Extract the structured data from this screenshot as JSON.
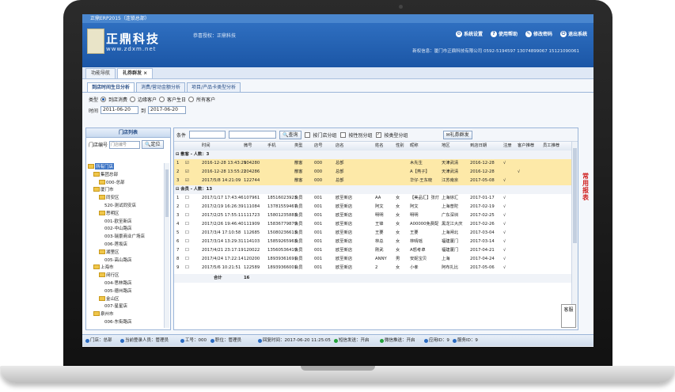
{
  "window": {
    "title": "正鼎ERP2015（连锁总部）"
  },
  "brand": {
    "name": "正鼎科技",
    "url": "www.zdxm.net"
  },
  "header": {
    "authorized": "恭喜授权：正鼎科技",
    "buttons": [
      "系统设置",
      "使用帮助",
      "修改密码",
      "退出系统"
    ],
    "new_info": "新权信息：厦门市正鼎科技有限公司  0592-5194597 13074899067 15121090061"
  },
  "tabs": [
    "功能导航",
    "礼券群发"
  ],
  "subtabs": [
    "到店时间生日分析",
    "消费/营动金额分析",
    "项目/产品卡类型分析"
  ],
  "filters": {
    "type_label": "类型",
    "type_options": [
      "到店消费",
      "边缘客户",
      "客户生日",
      "所有客户"
    ],
    "time_label": "时间",
    "date_from": "2011-06-20",
    "to_label": "到",
    "date_to": "2017-06-20"
  },
  "store_panel": {
    "title": "门店列表",
    "search_label": "门店编号",
    "search_placeholder": "门店编号",
    "locate_label": "定位",
    "tree": [
      {
        "label": "所有门店",
        "level": 0,
        "sel": true
      },
      {
        "label": "集团总部",
        "level": 1
      },
      {
        "label": "000-总部",
        "level": 2
      },
      {
        "label": "厦门市",
        "level": 1
      },
      {
        "label": "同安区",
        "level": 2
      },
      {
        "label": "520-测试同安店",
        "level": 3
      },
      {
        "label": "思明区",
        "level": 2
      },
      {
        "label": "001-欧至新店",
        "level": 3
      },
      {
        "label": "002-中山路店",
        "level": 3
      },
      {
        "label": "003-瑞景商业广场店",
        "level": 3
      },
      {
        "label": "006-莲坂店",
        "level": 3
      },
      {
        "label": "湖里区",
        "level": 2
      },
      {
        "label": "005-高山路店",
        "level": 3
      },
      {
        "label": "上海市",
        "level": 1
      },
      {
        "label": "闵行区",
        "level": 2
      },
      {
        "label": "004-思林路店",
        "level": 3
      },
      {
        "label": "005-德州路店",
        "level": 3
      },
      {
        "label": "金山区",
        "level": 2
      },
      {
        "label": "007-星星店",
        "level": 3
      },
      {
        "label": "泉州市",
        "level": 1
      },
      {
        "label": "006-东街路店",
        "level": 3
      }
    ]
  },
  "grid": {
    "toolbar": {
      "condition_label": "条件",
      "query_button": "查询",
      "group_by_store": "按门店分组",
      "group_by_gender": "按性别分组",
      "group_by_type": "按类型分组",
      "send_button": "礼券群发"
    },
    "columns": [
      "时间",
      "微号",
      "手机",
      "类型",
      "店号",
      "店名",
      "姓名",
      "性别",
      "昵称",
      "地区",
      "到店日期",
      "注册",
      "客户推荐",
      "员工推荐"
    ],
    "group1": "散客 - 人数：3",
    "rows1": [
      [
        "2016-12-28 13:43:29",
        "104280",
        "",
        "散客",
        "000",
        "总部",
        "",
        "",
        "木先生",
        "天津武清",
        "2016-12-28",
        "√",
        "",
        ""
      ],
      [
        "2016-12-28 13:55:22",
        "104286",
        "",
        "散客",
        "000",
        "总部",
        "",
        "",
        "A【燕子】",
        "天津武清",
        "2016-12-28",
        "",
        "√",
        ""
      ],
      [
        "2017/5/8 14:21:09",
        "122744",
        "",
        "散客",
        "000",
        "总部",
        "",
        "",
        "华仔·王东晓",
        "江苏南京",
        "2017-05-08",
        "√",
        "",
        ""
      ]
    ],
    "group2": "会员 - 人数：13",
    "rows2": [
      [
        "2017/1/17 17:43:46",
        "107961",
        "18516023923",
        "会员",
        "001",
        "欧至新店",
        "AA",
        "女",
        "【美品汇】张灯",
        "上海徐汇",
        "2017-01-17",
        "√",
        "",
        ""
      ],
      [
        "2017/2/19 16:26:39",
        "111084",
        "13781559467",
        "会员",
        "001",
        "欧至新店",
        "阿文",
        "女",
        "阿文",
        "上海普陀",
        "2017-02-19",
        "√",
        "",
        ""
      ],
      [
        "2017/2/25 17:55:11",
        "111723",
        "15801235883",
        "会员",
        "001",
        "欧至新店",
        "明明",
        "女",
        "明明",
        "广东深圳",
        "2017-02-25",
        "√",
        "",
        ""
      ],
      [
        "2017/2/26 19:46:40",
        "111909",
        "15836779879",
        "会员",
        "001",
        "欧至新店",
        "王锋",
        "女",
        "A00000免费配",
        "黑龙江大庆",
        "2017-02-26",
        "√",
        "",
        ""
      ],
      [
        "2017/3/4 17:10:58",
        "112685",
        "15080236613",
        "会员",
        "001",
        "欧至新店",
        "王要",
        "女",
        "王要",
        "上海闸北",
        "2017-03-04",
        "√",
        "",
        ""
      ],
      [
        "2017/3/14 13:29:31",
        "114103",
        "15859265963",
        "会员",
        "001",
        "欧至新店",
        "林总",
        "女",
        "林晴瑶",
        "福建厦门",
        "2017-03-14",
        "√",
        "",
        ""
      ],
      [
        "2017/4/21 23:17:19",
        "120022",
        "13560536419",
        "会员",
        "001",
        "欧至新店",
        "刚武",
        "女",
        "A怒考卓",
        "福建厦门",
        "2017-04-21",
        "√",
        "",
        ""
      ],
      [
        "2017/4/24 17:22:14",
        "120200",
        "18939361691",
        "会员",
        "001",
        "欧至新店",
        "ANNY",
        "男",
        "安妮宝贝",
        "上海",
        "2017-04-24",
        "√",
        "",
        ""
      ],
      [
        "2017/5/6 10:21:51",
        "122589",
        "18939366001",
        "会员",
        "001",
        "欧至新店",
        "2",
        "女",
        "小孝",
        "阿布扎比",
        "2017-05-06",
        "√",
        "",
        ""
      ]
    ],
    "total_label": "合计",
    "total_value": "16"
  },
  "side_text": "常用报表",
  "service_text": "客服",
  "statusbar": [
    {
      "label": "门店：总部",
      "color": "#2a6bc2"
    },
    {
      "label": "当前登录人员：管理员",
      "color": "#2a6bc2"
    },
    {
      "label": "工号：000",
      "color": "#2a6bc2"
    },
    {
      "label": "职位：管理员",
      "color": "#2a6bc2"
    },
    {
      "label": "回复时间：2017-06-20 11:25:05",
      "color": "#2a6bc2"
    },
    {
      "label": "短信发送：开启",
      "color": "#23a23a"
    },
    {
      "label": "微信推送：开启",
      "color": "#23a23a"
    },
    {
      "label": "应用ID：9",
      "color": "#2a6bc2"
    },
    {
      "label": "服务ID：9",
      "color": "#2a6bc2"
    }
  ]
}
